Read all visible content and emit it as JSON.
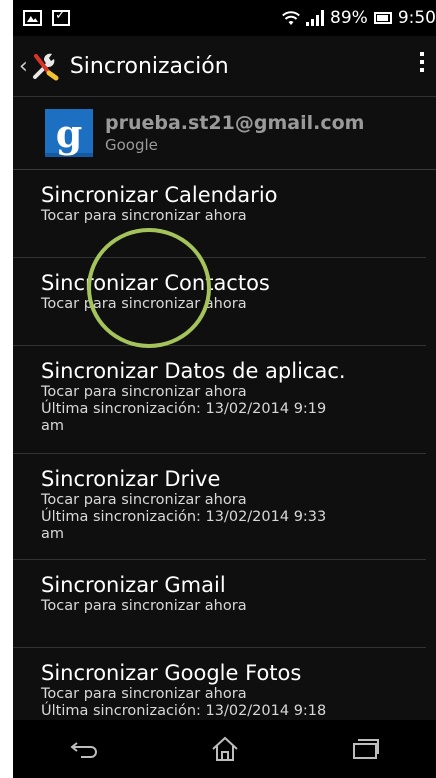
{
  "status_bar": {
    "battery": "89%",
    "time": "9:50"
  },
  "action_bar": {
    "title": "Sincronización"
  },
  "account": {
    "email": "prueba.st21@gmail.com",
    "type": "Google"
  },
  "sync_items": [
    {
      "title": "Sincronizar Calendario",
      "line1": "Tocar para sincronizar ahora",
      "line2": "",
      "line3": ""
    },
    {
      "title": "Sincronizar Contactos",
      "line1": "Tocar para sincronizar ahora",
      "line2": "",
      "line3": ""
    },
    {
      "title": "Sincronizar Datos de aplicac.",
      "line1": "Tocar para sincronizar ahora",
      "line2": "Última sincronización: 13/02/2014 9:19",
      "line3": "am"
    },
    {
      "title": "Sincronizar Drive",
      "line1": "Tocar para sincronizar ahora",
      "line2": "Última sincronización: 13/02/2014 9:33",
      "line3": "am"
    },
    {
      "title": "Sincronizar Gmail",
      "line1": "Tocar para sincronizar ahora",
      "line2": "",
      "line3": ""
    },
    {
      "title": "Sincronizar Google Fotos",
      "line1": "Tocar para sincronizar ahora",
      "line2": "Última sincronización: 13/02/2014 9:18",
      "line3": ""
    }
  ],
  "colors": {
    "background": "#0f0f10",
    "annotation_circle": "#a4c35a",
    "google_blue": "#1d6fc1"
  }
}
